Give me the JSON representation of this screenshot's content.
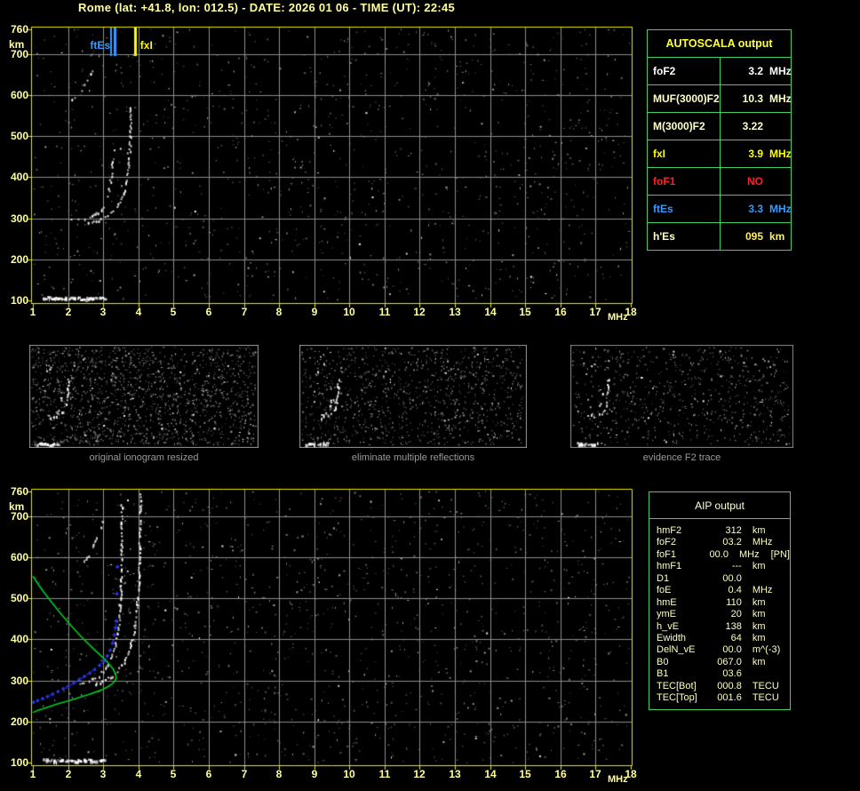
{
  "header": {
    "title": "Rome (lat: +41.8, lon: 012.5) - DATE: 2026 01 06 - TIME (UT): 22:45"
  },
  "colors": {
    "background": "#000000",
    "axis_border_yellow": "#e8e800",
    "axis_label_yellow": "#ffff9e",
    "grid_grey": "#8c8c8c",
    "table_border_green": "#3ecf5e",
    "autoscala_title_yellow": "#ffff40",
    "ftEs_blue": "#3898ff",
    "fxI_yellow": "#ffff00",
    "foF1_red": "#ff2020",
    "cream_text": "#ffffc8",
    "profile_green": "#00cc22",
    "restored_trace_blue": "#2e3cff",
    "caption_grey": "#9a9a9a"
  },
  "autoscala": {
    "title": "AUTOSCALA output",
    "rows": [
      {
        "label": "foF2",
        "value": "3.2",
        "unit": "MHz",
        "color": "#ffffff"
      },
      {
        "label": "MUF(3000)F2",
        "value": "10.3",
        "unit": "MHz",
        "color": "#ffffc8"
      },
      {
        "label": "M(3000)F2",
        "value": "3.22",
        "unit": "",
        "color": "#ffffc8"
      },
      {
        "label": "fxI",
        "value": "3.9",
        "unit": "MHz",
        "color": "#ffff00"
      },
      {
        "label": "foF1",
        "value": "NO",
        "unit": "",
        "color": "#ff2020"
      },
      {
        "label": "ftEs",
        "value": "3.3",
        "unit": "MHz",
        "color": "#3898ff"
      },
      {
        "label": "h'Es",
        "value": "095",
        "unit": "km",
        "color": "#ffffc8",
        "value_color": "#ffee60"
      }
    ]
  },
  "aip": {
    "title": "AIP output",
    "rows": [
      {
        "label": "hmF2",
        "value": "312",
        "unit": "km",
        "extra": ""
      },
      {
        "label": "foF2",
        "value": "03.2",
        "unit": "MHz",
        "extra": ""
      },
      {
        "label": "foF1",
        "value": "00.0",
        "unit": "MHz",
        "extra": "[PN]"
      },
      {
        "label": "hmF1",
        "value": "---",
        "unit": "km",
        "extra": ""
      },
      {
        "label": "D1",
        "value": "00.0",
        "unit": "",
        "extra": ""
      },
      {
        "label": "foE",
        "value": "0.4",
        "unit": "MHz",
        "extra": ""
      },
      {
        "label": "hmE",
        "value": "110",
        "unit": "km",
        "extra": ""
      },
      {
        "label": "ymE",
        "value": "20",
        "unit": "km",
        "extra": ""
      },
      {
        "label": "h_vE",
        "value": "138",
        "unit": "km",
        "extra": ""
      },
      {
        "label": "Ewidth",
        "value": "64",
        "unit": "km",
        "extra": ""
      },
      {
        "label": "DelN_vE",
        "value": "00.0",
        "unit": "m^(-3)",
        "extra": ""
      },
      {
        "label": "B0",
        "value": "067.0",
        "unit": "km",
        "extra": ""
      },
      {
        "label": "B1",
        "value": "03.6",
        "unit": "",
        "extra": ""
      },
      {
        "label": "TEC[Bot]",
        "value": "000.8",
        "unit": "TECU",
        "extra": ""
      },
      {
        "label": "TEC[Top]",
        "value": "001.6",
        "unit": "TECU",
        "extra": ""
      }
    ]
  },
  "thumbnails": [
    {
      "caption": "original ionogram resized"
    },
    {
      "caption": "eliminate multiple reflections"
    },
    {
      "caption": "evidence F2 trace"
    }
  ],
  "chart_data": [
    {
      "type": "scatter",
      "title": "scaled ionogram (virtual height vs frequency)",
      "xlabel": "MHz",
      "ylabel": "km",
      "xlim": [
        1,
        18
      ],
      "ylim": [
        100,
        760
      ],
      "xticks": [
        1,
        2,
        3,
        4,
        5,
        6,
        7,
        8,
        9,
        10,
        11,
        12,
        13,
        14,
        15,
        16,
        17,
        18
      ],
      "yticks": [
        760,
        700,
        600,
        500,
        400,
        300,
        200,
        100
      ],
      "grid": true,
      "markers": [
        {
          "name": "ftEs",
          "freq_mhz": 3.3,
          "color": "#3898ff"
        },
        {
          "name": "fxI",
          "freq_mhz": 3.9,
          "color": "#ffff00"
        }
      ],
      "series": [
        {
          "name": "Es-layer-echo",
          "style": "es",
          "color": "#ffffff",
          "points": [
            [
              1.3,
              108
            ],
            [
              1.6,
              106
            ],
            [
              1.9,
              107
            ],
            [
              2.2,
              106
            ],
            [
              2.6,
              107
            ],
            [
              3.0,
              108
            ]
          ]
        },
        {
          "name": "F2-ordinary-trace",
          "style": "echo-faint",
          "color": "#ffffff",
          "points": [
            [
              2.05,
              296
            ],
            [
              2.25,
              297
            ],
            [
              2.45,
              300
            ],
            [
              2.65,
              306
            ],
            [
              2.85,
              316
            ],
            [
              3.0,
              331
            ],
            [
              3.1,
              352
            ],
            [
              3.17,
              378
            ],
            [
              3.22,
              408
            ],
            [
              3.26,
              442
            ],
            [
              3.28,
              472
            ]
          ]
        },
        {
          "name": "F2-extraordinary-trace",
          "style": "echo",
          "color": "#ffffff",
          "points": [
            [
              2.45,
              289
            ],
            [
              2.65,
              292
            ],
            [
              2.85,
              297
            ],
            [
              3.05,
              305
            ],
            [
              3.25,
              317
            ],
            [
              3.4,
              332
            ],
            [
              3.52,
              353
            ],
            [
              3.62,
              381
            ],
            [
              3.69,
              415
            ],
            [
              3.73,
              455
            ],
            [
              3.75,
              500
            ],
            [
              3.76,
              545
            ],
            [
              3.77,
              576
            ]
          ]
        },
        {
          "name": "second-hop-echo",
          "style": "echo-faint",
          "color": "#ffffff",
          "points": [
            [
              2.05,
              590
            ],
            [
              2.2,
              600
            ],
            [
              2.35,
              613
            ],
            [
              2.5,
              630
            ],
            [
              2.62,
              648
            ],
            [
              2.72,
              665
            ]
          ]
        }
      ]
    },
    {
      "type": "scatter",
      "title": "ionogram with restored trace and electron density profile",
      "xlabel": "MHz",
      "ylabel": "km",
      "xlim": [
        1,
        18
      ],
      "ylim": [
        100,
        760
      ],
      "xticks": [
        1,
        2,
        3,
        4,
        5,
        6,
        7,
        8,
        9,
        10,
        11,
        12,
        13,
        14,
        15,
        16,
        17,
        18
      ],
      "yticks": [
        760,
        700,
        600,
        500,
        400,
        300,
        200,
        100
      ],
      "grid": true,
      "markers": [],
      "series": [
        {
          "name": "Es-layer-echo",
          "style": "es",
          "color": "#ffffff",
          "points": [
            [
              1.3,
              108
            ],
            [
              1.6,
              106
            ],
            [
              1.9,
              107
            ],
            [
              2.2,
              106
            ],
            [
              2.6,
              107
            ],
            [
              3.0,
              108
            ]
          ]
        },
        {
          "name": "F2-ordinary-trace",
          "style": "echo",
          "color": "#ffffff",
          "points": [
            [
              2.3,
              293
            ],
            [
              2.5,
              298
            ],
            [
              2.7,
              305
            ],
            [
              2.9,
              315
            ],
            [
              3.05,
              329
            ],
            [
              3.2,
              350
            ],
            [
              3.3,
              377
            ],
            [
              3.38,
              412
            ],
            [
              3.44,
              452
            ],
            [
              3.47,
              498
            ],
            [
              3.49,
              550
            ],
            [
              3.5,
              610
            ],
            [
              3.51,
              675
            ],
            [
              3.51,
              745
            ]
          ]
        },
        {
          "name": "F2-extraordinary-trace",
          "style": "echo",
          "color": "#ffffff",
          "points": [
            [
              2.62,
              289
            ],
            [
              2.82,
              294
            ],
            [
              3.02,
              302
            ],
            [
              3.22,
              313
            ],
            [
              3.42,
              329
            ],
            [
              3.6,
              351
            ],
            [
              3.75,
              382
            ],
            [
              3.86,
              422
            ],
            [
              3.93,
              468
            ],
            [
              3.98,
              520
            ],
            [
              4.01,
              585
            ],
            [
              4.03,
              655
            ],
            [
              4.04,
              725
            ],
            [
              4.04,
              758
            ]
          ]
        },
        {
          "name": "second-hop-echo",
          "style": "echo-faint",
          "color": "#ffffff",
          "points": [
            [
              2.45,
              593
            ],
            [
              2.58,
              612
            ],
            [
              2.72,
              636
            ],
            [
              2.86,
              662
            ],
            [
              2.98,
              690
            ]
          ]
        },
        {
          "name": "electron-density-profile",
          "style": "line",
          "color": "#00cc22",
          "points": [
            [
              1.0,
              554
            ],
            [
              1.2,
              528
            ],
            [
              1.5,
              494
            ],
            [
              1.8,
              462
            ],
            [
              2.1,
              432
            ],
            [
              2.4,
              404
            ],
            [
              2.7,
              379
            ],
            [
              2.95,
              359
            ],
            [
              3.15,
              342
            ],
            [
              3.28,
              328
            ],
            [
              3.36,
              314
            ],
            [
              3.36,
              303
            ],
            [
              3.28,
              293
            ],
            [
              3.12,
              284
            ],
            [
              2.9,
              275
            ],
            [
              2.6,
              266
            ],
            [
              2.3,
              258
            ],
            [
              2.0,
              250
            ],
            [
              1.7,
              243
            ],
            [
              1.4,
              234
            ],
            [
              1.15,
              227
            ],
            [
              1.0,
              222
            ]
          ]
        },
        {
          "name": "restored-trace",
          "style": "plus",
          "color": "#2e3cff",
          "points": [
            [
              1.0,
              248
            ],
            [
              1.12,
              252
            ],
            [
              1.26,
              257
            ],
            [
              1.4,
              262
            ],
            [
              1.55,
              268
            ],
            [
              1.7,
              274
            ],
            [
              1.85,
              281
            ],
            [
              2.0,
              288
            ],
            [
              2.15,
              295
            ],
            [
              2.3,
              303
            ],
            [
              2.45,
              311
            ],
            [
              2.6,
              319
            ],
            [
              2.74,
              328
            ],
            [
              2.88,
              338
            ],
            [
              3.0,
              349
            ],
            [
              3.1,
              361
            ],
            [
              3.18,
              375
            ],
            [
              3.25,
              392
            ],
            [
              3.3,
              412
            ],
            [
              3.33,
              430
            ],
            [
              3.35,
              446
            ],
            [
              3.37,
              512
            ],
            [
              3.39,
              578
            ]
          ]
        }
      ]
    }
  ]
}
